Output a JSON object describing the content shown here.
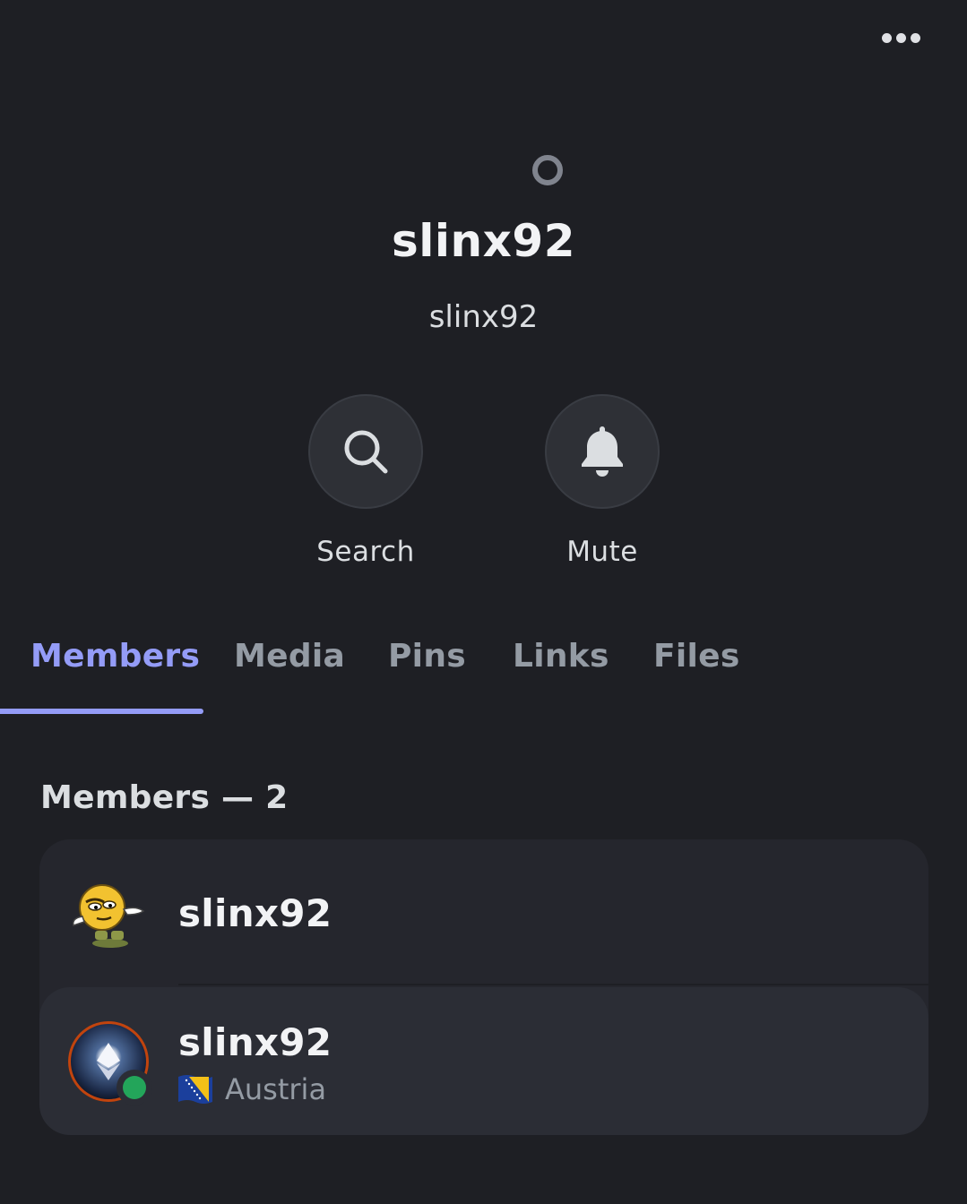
{
  "header": {
    "more_icon": "more-horizontal-icon"
  },
  "profile": {
    "display_name": "slinx92",
    "username": "slinx92",
    "status_icon": "offline-status-icon"
  },
  "actions": [
    {
      "label": "Search",
      "icon": "search-icon"
    },
    {
      "label": "Mute",
      "icon": "bell-icon"
    }
  ],
  "tabs": [
    {
      "label": "Members",
      "active": true
    },
    {
      "label": "Media",
      "active": false
    },
    {
      "label": "Pins",
      "active": false
    },
    {
      "label": "Links",
      "active": false
    },
    {
      "label": "Files",
      "active": false
    }
  ],
  "members_section": {
    "title": "Members — 2",
    "members": [
      {
        "name": "slinx92",
        "status_text": "",
        "presence": "none"
      },
      {
        "name": "slinx92",
        "status_text": "Austria",
        "presence": "online",
        "status_emoji": "flag-bosnia-icon"
      }
    ]
  },
  "colors": {
    "background": "#1e1f24",
    "accent": "#949cf7",
    "online": "#23a55a",
    "card": "#25262d"
  }
}
